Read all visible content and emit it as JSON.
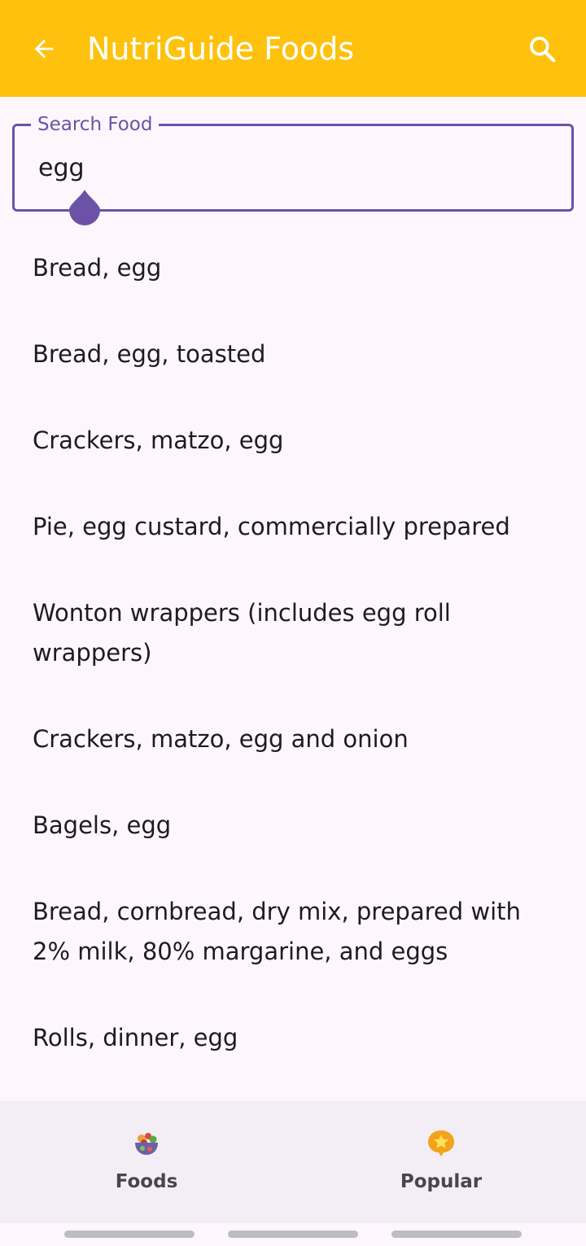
{
  "app_bar": {
    "title": "NutriGuide Foods",
    "back_icon": "arrow-left-icon",
    "search_icon": "search-icon",
    "background_color": "#fec20e"
  },
  "search": {
    "label": "Search Food",
    "value": "egg",
    "accent_color": "#6c52a6"
  },
  "results": [
    "Bread, egg",
    "Bread, egg, toasted",
    "Crackers, matzo, egg",
    "Pie, egg custard, commercially prepared",
    "Wonton wrappers (includes egg roll wrappers)",
    "Crackers, matzo, egg and onion",
    "Bagels, egg",
    "Bread, cornbread, dry mix, prepared with 2% milk, 80% margarine, and eggs",
    "Rolls, dinner, egg"
  ],
  "bottom_nav": {
    "items": [
      {
        "label": "Foods",
        "icon": "food-bowl-icon"
      },
      {
        "label": "Popular",
        "icon": "star-badge-icon"
      }
    ]
  }
}
